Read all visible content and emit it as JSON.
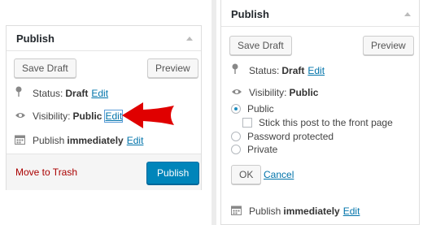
{
  "left": {
    "title": "Publish",
    "save_draft": "Save Draft",
    "preview": "Preview",
    "status_label": "Status:",
    "status_value": "Draft",
    "edit": "Edit",
    "visibility_label": "Visibility:",
    "visibility_value": "Public",
    "publish_label": "Publish",
    "publish_value": "immediately",
    "move_to_trash": "Move to Trash",
    "publish_button": "Publish"
  },
  "right": {
    "title": "Publish",
    "save_draft": "Save Draft",
    "preview": "Preview",
    "status_label": "Status:",
    "status_value": "Draft",
    "edit": "Edit",
    "visibility_label": "Visibility:",
    "visibility_value": "Public",
    "options": {
      "public": "Public",
      "sticky": "Stick this post to the front page",
      "password": "Password protected",
      "private": "Private"
    },
    "ok": "OK",
    "cancel": "Cancel",
    "publish_label": "Publish",
    "publish_value": "immediately"
  },
  "colors": {
    "accent": "#0073aa",
    "primary_button": "#0085ba",
    "trash": "#aa0000",
    "arrow": "#e00000"
  }
}
